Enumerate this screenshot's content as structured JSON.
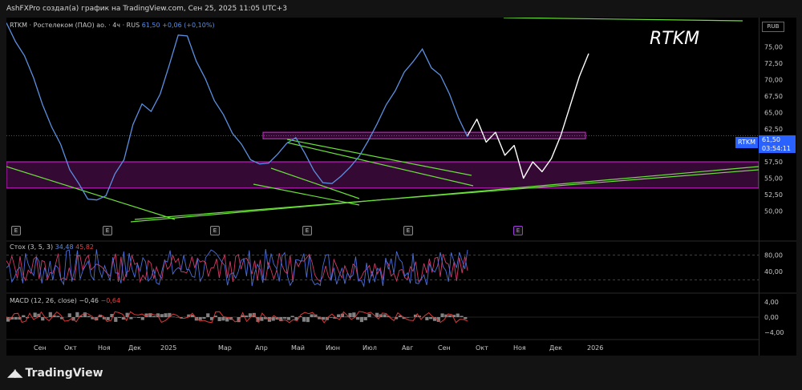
{
  "header": {
    "caption": "AshFXPro создал(а) график на TradingView.com, Сен 25, 2025 11:05 UTC+3"
  },
  "symbol_legend": {
    "ticker": "RTKM · Ростелеком (ПАО) ао. · 4ч · RUS",
    "price": "61,50",
    "change": "+0,06 (+0,10%)"
  },
  "annotation": {
    "title": "RTKM"
  },
  "currency_button": "RUB",
  "price_label": {
    "symbol": "RTKM",
    "price": "61,50",
    "countdown": "03:54:11"
  },
  "earnings_markers": [
    "E",
    "E",
    "E",
    "E",
    "E"
  ],
  "dividend_marker": "E",
  "stoch_legend": {
    "name": "Стох (3, 5, 3)",
    "k": "34,48",
    "d": "45,82"
  },
  "macd_legend": {
    "name": "MACD (12, 26, close)",
    "macd": "−0,46",
    "signal": "−0,64"
  },
  "logo": {
    "text": "TradingView"
  },
  "colors": {
    "price_line": "#5b8fe0",
    "zone_fill": "#3d0a3d",
    "zone_border": "#c01ec0",
    "trendline": "#6adf3a",
    "stoch_k": "#4a6fd8",
    "stoch_d": "#d13b6a",
    "macd_line": "#d83a3a"
  },
  "chart_data": [
    {
      "type": "line",
      "title": "",
      "ylabel": "",
      "ylim": [
        47.5,
        78.5
      ],
      "yticks": [
        "75,00",
        "72,50",
        "70,00",
        "67,50",
        "65,00",
        "62,50",
        "57,50",
        "55,00",
        "52,50",
        "50,00"
      ],
      "xticks": [
        "Сен",
        "Окт",
        "Ноя",
        "Дек",
        "2025",
        "Мар",
        "Апр",
        "Май",
        "Июн",
        "Июл",
        "Авг",
        "Сен",
        "Окт",
        "Ноя",
        "Дек",
        "2026"
      ],
      "series": [
        {
          "values": [
            78.5,
            76.0,
            73.5,
            70.5,
            66.0,
            63.0,
            60.0,
            56.5,
            54.0,
            52.0,
            51.5,
            52.5,
            55.5,
            58.0,
            63.0,
            66.5,
            65.0,
            68.0,
            72.0,
            77.0,
            76.5,
            73.0,
            70.0,
            67.0,
            64.5,
            62.0,
            60.0,
            58.0,
            57.0,
            57.5,
            58.5,
            60.5,
            61.0,
            59.0,
            56.0,
            54.5,
            54.0,
            55.5,
            56.5,
            58.5,
            60.5,
            63.5,
            66.0,
            68.5,
            71.0,
            73.0,
            74.5,
            72.0,
            70.5,
            68.0,
            64.0,
            61.5
          ]
        }
      ],
      "zones": [
        {
          "from": 61.0,
          "to": 62.0,
          "label": ""
        },
        {
          "from": 53.5,
          "to": 57.5,
          "label": ""
        }
      ],
      "projection": [
        61.5,
        64.0,
        60.5,
        62.0,
        58.5,
        60.0,
        55.0,
        57.5,
        56.0,
        58.0,
        61.5,
        66.0,
        70.5,
        74.0
      ]
    },
    {
      "type": "line",
      "title": "Стох (3, 5, 3)",
      "yticks": [
        "80,00",
        "40,00"
      ],
      "ylim": [
        0,
        100
      ],
      "series": [
        {
          "name": "K",
          "values": [
            34.48
          ]
        },
        {
          "name": "D",
          "values": [
            45.82
          ]
        }
      ]
    },
    {
      "type": "line",
      "title": "MACD (12, 26, close)",
      "yticks": [
        "4,00",
        "0,00",
        "−4,00"
      ],
      "ylim": [
        -5,
        5
      ],
      "series": [
        {
          "name": "MACD",
          "values": [
            -0.46
          ]
        },
        {
          "name": "Signal",
          "values": [
            -0.64
          ]
        }
      ]
    }
  ]
}
